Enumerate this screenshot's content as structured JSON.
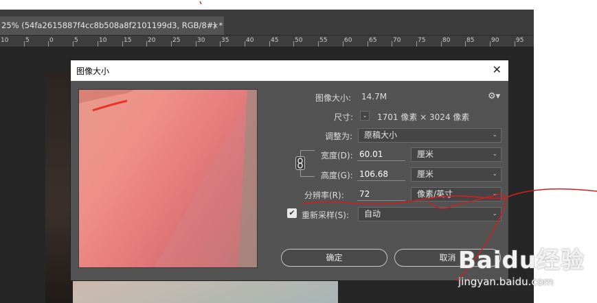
{
  "document_tab": {
    "title": "25% (54fa2615887f4cc8b508a8f2101199d3, RGB/8#) *",
    "close_glyph": "×"
  },
  "ruler": {
    "labels": [
      "10",
      "5",
      "0",
      "5",
      "10",
      "15",
      "20",
      "25",
      "30",
      "35",
      "40",
      "45",
      "50",
      "55",
      "60",
      "65",
      "70",
      "75",
      "80",
      "85",
      "90",
      "95"
    ]
  },
  "dialog": {
    "title": "图像大小",
    "close_glyph": "✕",
    "image_size_label": "图像大小:",
    "image_size_value": "14.7M",
    "dimensions_label": "尺寸:",
    "dimensions_value": "1701 像素 × 3024 像素",
    "fit_to_label": "调整为:",
    "fit_to_value": "原稿大小",
    "width_label": "宽度(D):",
    "width_value": "60.01",
    "width_unit": "厘米",
    "height_label": "高度(G):",
    "height_value": "106.68",
    "height_unit": "厘米",
    "resolution_label": "分辨率(R):",
    "resolution_value": "72",
    "resolution_unit": "像素/英寸",
    "resample_label": "重新采样(S):",
    "resample_checked": true,
    "resample_value": "自动",
    "ok_label": "确定",
    "cancel_label": "取消",
    "caret_glyph": "⌄"
  },
  "watermark": {
    "logo": "Baidu经验",
    "url": "jingyan.baidu.com"
  },
  "colors": {
    "annotation_red": "#d11f1f",
    "dialog_bg": "#535353",
    "workspace_bg": "#262626"
  },
  "icons": {
    "settings": "gear-icon",
    "link": "chain-link-icon",
    "checkbox": "checkmark-icon"
  }
}
